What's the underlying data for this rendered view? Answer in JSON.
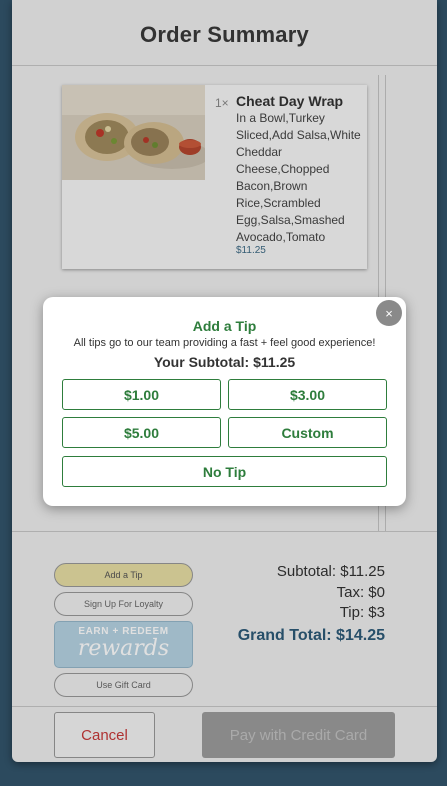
{
  "header": {
    "title": "Order Summary"
  },
  "order_items": [
    {
      "qty": "1×",
      "name": "Cheat Day Wrap",
      "modifiers": "In a Bowl,Turkey Sliced,Add Salsa,White Cheddar Cheese,Chopped Bacon,Brown Rice,Scrambled Egg,Salsa,Smashed Avocado,Tomato",
      "price": "$11.25"
    }
  ],
  "actions": {
    "add_tip": "Add a Tip",
    "loyalty": "Sign Up For Loyalty",
    "rewards_line1": "EARN + REDEEM",
    "rewards_line2": "rewards",
    "gift_card": "Use Gift Card"
  },
  "totals": {
    "subtotal": "Subtotal: $11.25",
    "tax": "Tax: $0",
    "tip": "Tip: $3",
    "grand_total": "Grand Total: $14.25"
  },
  "footer": {
    "cancel_label": "Cancel",
    "pay_label": "Pay with Credit Card"
  },
  "tip_modal": {
    "close_glyph": "×",
    "title": "Add a Tip",
    "subtitle": "All tips go to our team providing a fast + feel good experience!",
    "subtotal": "Your Subtotal: $11.25",
    "options": [
      "$1.00",
      "$3.00",
      "$5.00",
      "Custom"
    ],
    "no_tip": "No Tip"
  },
  "colors": {
    "background": "#2c4a5e",
    "accent_green": "#2e7d3c",
    "grand_total_blue": "#2d5a78",
    "cancel_red": "#c83a3a"
  }
}
